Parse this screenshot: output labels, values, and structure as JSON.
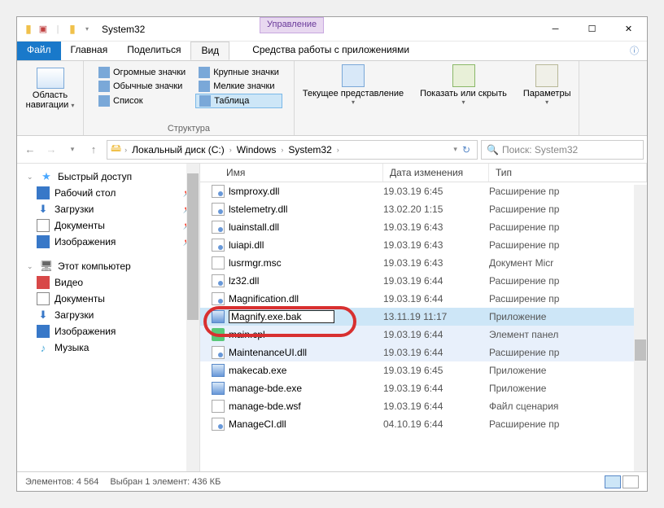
{
  "title": "System32",
  "purple_tab": "Управление",
  "tabs": {
    "file": "Файл",
    "home": "Главная",
    "share": "Поделиться",
    "view": "Вид",
    "app_tools": "Средства работы с приложениями"
  },
  "ribbon": {
    "nav": {
      "label": "Область\nнавигации",
      "group": ""
    },
    "layout": {
      "huge": "Огромные значки",
      "large": "Крупные значки",
      "normal": "Обычные значки",
      "small": "Мелкие значки",
      "list": "Список",
      "table": "Таблица",
      "group": "Структура"
    },
    "view": {
      "current": "Текущее\nпредставление",
      "show": "Показать\nили скрыть",
      "params": "Параметры"
    }
  },
  "breadcrumb": [
    "Локальный диск (C:)",
    "Windows",
    "System32"
  ],
  "search_placeholder": "Поиск: System32",
  "sidebar": {
    "quick": "Быстрый доступ",
    "desktop": "Рабочий стол",
    "downloads": "Загрузки",
    "documents": "Документы",
    "pictures": "Изображения",
    "thispc": "Этот компьютер",
    "video": "Видео",
    "documents2": "Документы",
    "downloads2": "Загрузки",
    "pictures2": "Изображения",
    "music": "Музыка"
  },
  "columns": {
    "name": "Имя",
    "date": "Дата изменения",
    "type": "Тип"
  },
  "files": [
    {
      "name": "lsmproxy.dll",
      "date": "19.03.19 6:45",
      "type": "Расширение пр",
      "icon": "dll"
    },
    {
      "name": "lstelemetry.dll",
      "date": "13.02.20 1:15",
      "type": "Расширение пр",
      "icon": "dll"
    },
    {
      "name": "luainstall.dll",
      "date": "19.03.19 6:43",
      "type": "Расширение пр",
      "icon": "dll"
    },
    {
      "name": "luiapi.dll",
      "date": "19.03.19 6:43",
      "type": "Расширение пр",
      "icon": "dll"
    },
    {
      "name": "lusrmgr.msc",
      "date": "19.03.19 6:43",
      "type": "Документ Micr",
      "icon": "msc"
    },
    {
      "name": "lz32.dll",
      "date": "19.03.19 6:44",
      "type": "Расширение пр",
      "icon": "dll"
    },
    {
      "name": "Magnification.dll",
      "date": "19.03.19 6:44",
      "type": "Расширение пр",
      "icon": "dll"
    },
    {
      "name": "Magnify.exe.bak",
      "date": "13.11.19 11:17",
      "type": "Приложение",
      "icon": "exe",
      "selected": true,
      "rename": true
    },
    {
      "name": "main.cpl",
      "date": "19.03.19 6:44",
      "type": "Элемент панел",
      "icon": "cpl",
      "alt": true
    },
    {
      "name": "MaintenanceUI.dll",
      "date": "19.03.19 6:44",
      "type": "Расширение пр",
      "icon": "dll",
      "alt": true
    },
    {
      "name": "makecab.exe",
      "date": "19.03.19 6:45",
      "type": "Приложение",
      "icon": "exe"
    },
    {
      "name": "manage-bde.exe",
      "date": "19.03.19 6:44",
      "type": "Приложение",
      "icon": "exe"
    },
    {
      "name": "manage-bde.wsf",
      "date": "19.03.19 6:44",
      "type": "Файл сценария",
      "icon": "wsf"
    },
    {
      "name": "ManageCI.dll",
      "date": "04.10.19 6:44",
      "type": "Расширение пр",
      "icon": "dll"
    }
  ],
  "status": {
    "count": "Элементов: 4 564",
    "selected": "Выбран 1 элемент: 436 КБ"
  }
}
